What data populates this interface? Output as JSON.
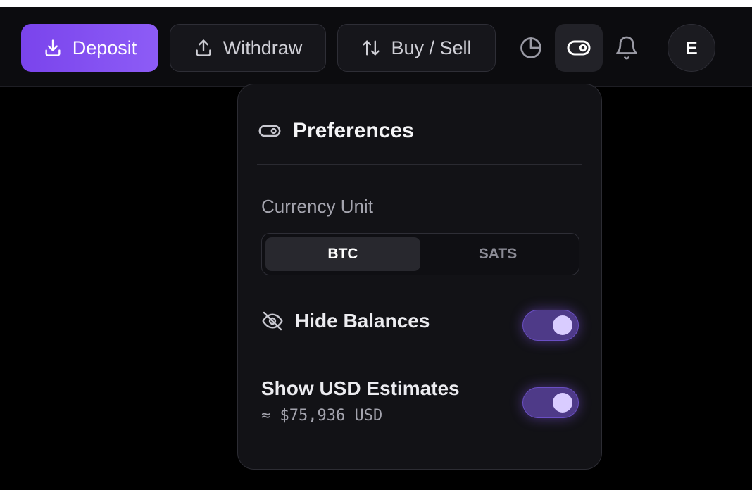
{
  "header": {
    "deposit_label": "Deposit",
    "withdraw_label": "Withdraw",
    "buysell_label": "Buy / Sell",
    "avatar_initial": "E",
    "accent_color": "#8b5cf6"
  },
  "preferences": {
    "title": "Preferences",
    "currency_unit_label": "Currency Unit",
    "currency_options": [
      "BTC",
      "SATS"
    ],
    "currency_selected": "BTC",
    "hide_balances_label": "Hide Balances",
    "hide_balances_on": true,
    "show_usd_label": "Show USD Estimates",
    "show_usd_on": true,
    "usd_estimate": "≈ $75,936 USD"
  },
  "icons": [
    "download-icon",
    "upload-icon",
    "arrows-up-down-icon",
    "pie-chart-icon",
    "toggle-icon",
    "bell-icon",
    "eye-off-icon"
  ]
}
